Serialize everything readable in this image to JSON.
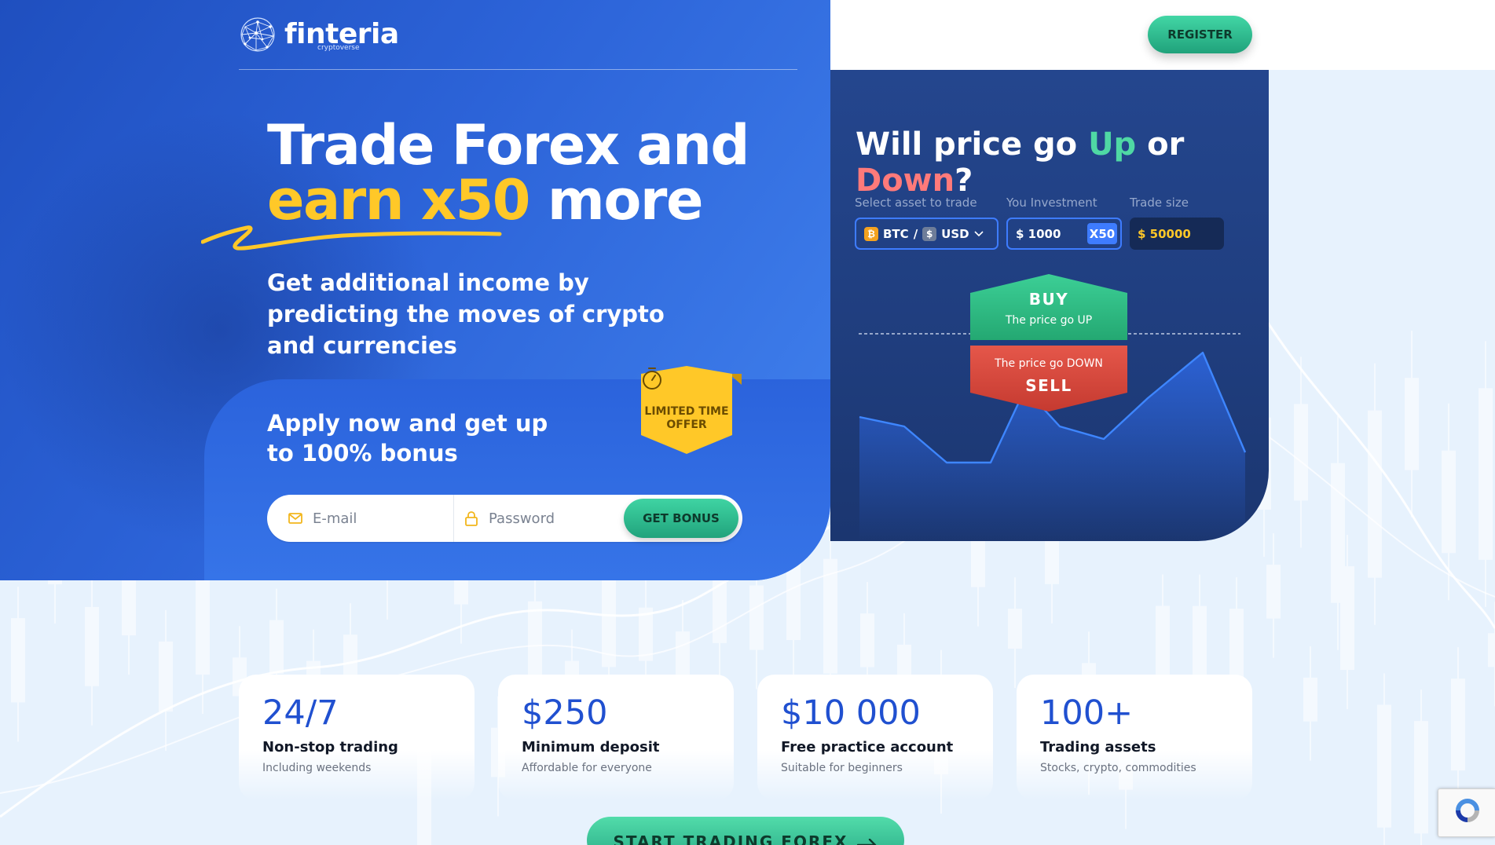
{
  "brand": {
    "name": "finteria",
    "tagline": "cryptoverse"
  },
  "header": {
    "register_label": "REGISTER"
  },
  "hero": {
    "headline_line1": "Trade Forex and",
    "headline_highlight": "earn x50",
    "headline_tail": "more",
    "subheadline": "Get additional income by predicting the moves of crypto and currencies",
    "bonus_title": "Apply now and get up to 100% bonus",
    "badge_text": "LIMITED TIME OFFER",
    "email_placeholder": "E-mail",
    "password_placeholder": "Password",
    "get_bonus_label": "GET BONUS"
  },
  "trade_widget": {
    "title_prefix": "Will price go ",
    "title_up": "Up",
    "title_mid": " or ",
    "title_down": "Down",
    "title_suffix": "?",
    "asset_label": "Select asset to trade",
    "investment_label": "You Investment",
    "size_label": "Trade size",
    "asset_base": "BTC",
    "asset_sep": "/",
    "asset_quote": "USD",
    "investment_value": "$ 1000",
    "multiplier": "X50",
    "trade_size_value": "$ 50000",
    "buy_label": "BUY",
    "buy_sub": "The price go UP",
    "sell_label": "SELL",
    "sell_sub": "The price go DOWN"
  },
  "stats": [
    {
      "value": "24/7",
      "title": "Non-stop trading",
      "subtitle": "Including weekends"
    },
    {
      "value": "$250",
      "title": "Minimum deposit",
      "subtitle": "Affordable for everyone"
    },
    {
      "value": "$10 000",
      "title": "Free practice account",
      "subtitle": "Suitable for beginners"
    },
    {
      "value": "100+",
      "title": "Trading assets",
      "subtitle": "Stocks, crypto, commodities"
    }
  ],
  "cta": {
    "label": "START TRADING FOREX"
  },
  "colors": {
    "primary": "#2c63d8",
    "accent_yellow": "#ffc828",
    "green": "#2bb98b",
    "red": "#d94a3c",
    "navy": "#1f3d7d"
  }
}
